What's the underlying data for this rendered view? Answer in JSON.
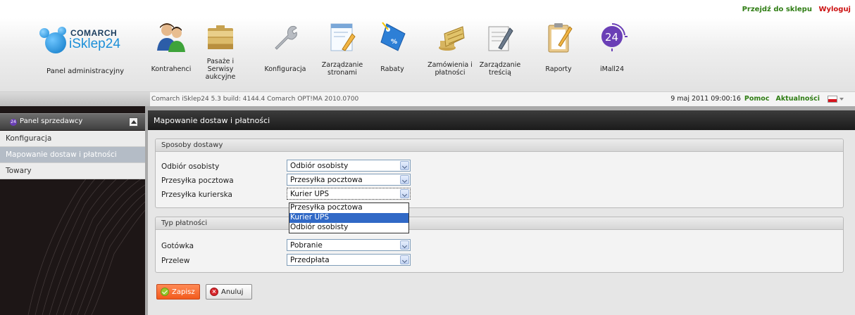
{
  "header": {
    "goto_shop": "Przejdź do sklepu",
    "logout": "Wyloguj",
    "logo_brand": "COMARCH",
    "logo_product": "iSklep24",
    "admin_panel": "Panel administracyjny",
    "nav": [
      {
        "label": "Kontrahenci",
        "icon": "users-icon"
      },
      {
        "label": "Pasaże i Serwisy aukcyjne",
        "icon": "folder-stack-icon"
      },
      {
        "label": "Konfiguracja",
        "icon": "wrench-icon"
      },
      {
        "label": "Zarządzanie stronami",
        "icon": "page-edit-icon"
      },
      {
        "label": "Rabaty",
        "icon": "price-tag-icon"
      },
      {
        "label": "Zamówienia i płatności",
        "icon": "shopping-basket-icon"
      },
      {
        "label": "Zarządzanie treścią",
        "icon": "notepad-edit-icon"
      },
      {
        "label": "Raporty",
        "icon": "clipboard-icon"
      },
      {
        "label": "iMall24",
        "icon": "imall24-icon",
        "icon_text": "24"
      }
    ]
  },
  "statusbar": {
    "version": "Comarch iSklep24 5.3 build: 4144.4 Comarch OPT!MA 2010.0700",
    "datetime": "9 maj 2011 09:00:16",
    "help": "Pomoc",
    "news": "Aktualności"
  },
  "sidebar": {
    "title": "Panel sprzedawcy",
    "badge": "24",
    "items": [
      {
        "label": "Konfiguracja",
        "active": false
      },
      {
        "label": "Mapowanie dostaw i płatności",
        "active": true
      },
      {
        "label": "Towary",
        "active": false
      }
    ]
  },
  "main": {
    "title": "Mapowanie dostaw i płatności",
    "delivery": {
      "title": "Sposoby dostawy",
      "rows": [
        {
          "label": "Odbiór osobisty",
          "value": "Odbiór osobisty"
        },
        {
          "label": "Przesyłka pocztowa",
          "value": "Przesyłka pocztowa"
        },
        {
          "label": "Przesyłka kurierska",
          "value": "Kurier UPS"
        }
      ],
      "dropdown_options": [
        "Przesyłka pocztowa",
        "Kurier UPS",
        "Odbiór osobisty"
      ],
      "dropdown_selected": "Kurier UPS"
    },
    "payment": {
      "title": "Typ płatności",
      "rows": [
        {
          "label": "Gotówka",
          "value": "Pobranie"
        },
        {
          "label": "Przelew",
          "value": "Przedpłata"
        }
      ]
    },
    "buttons": {
      "save": "Zapisz",
      "cancel": "Anuluj"
    }
  },
  "colors": {
    "accent_green": "#2f7d14",
    "logout_red": "#cc1111",
    "save_orange": "#f25a1c",
    "selection_blue": "#3169c6"
  }
}
